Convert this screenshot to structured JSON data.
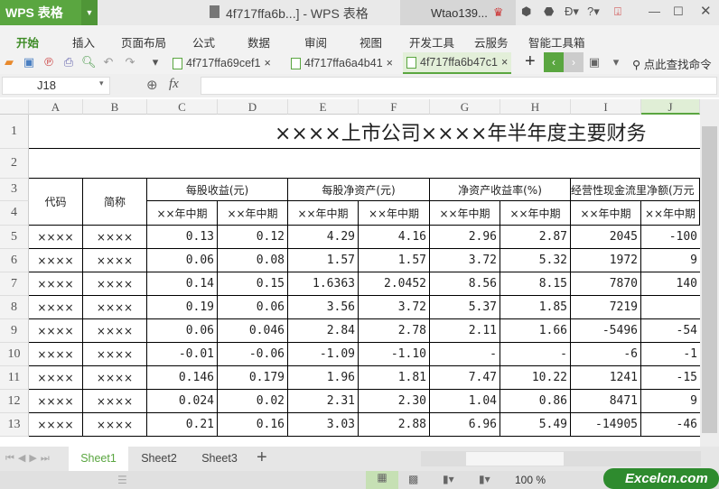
{
  "app": {
    "name": "WPS 表格",
    "doc_title": "4f717ffa6b...] - WPS 表格",
    "user": "Wtao139..."
  },
  "menu": [
    "开始",
    "插入",
    "页面布局",
    "公式",
    "数据",
    "审阅",
    "视图",
    "开发工具",
    "云服务",
    "智能工具箱"
  ],
  "doc_tabs": [
    {
      "label": "4f717ffa69cef1",
      "active": false
    },
    {
      "label": "4f717ffa6a4b41",
      "active": false
    },
    {
      "label": "4f717ffa6b47c1",
      "active": true
    }
  ],
  "search_cmd": "点此查找命令",
  "name_box": "J18",
  "fx": "fx",
  "columns": [
    "A",
    "B",
    "C",
    "D",
    "E",
    "F",
    "G",
    "H",
    "I",
    "J"
  ],
  "selected_column": "J",
  "rows": [
    "1",
    "2",
    "3",
    "4",
    "5",
    "6",
    "7",
    "8",
    "9",
    "10",
    "11",
    "12",
    "13"
  ],
  "table": {
    "title": "××××上市公司××××年半年度主要财务",
    "h_code": "代码",
    "h_name": "简称",
    "groups": [
      "每股收益(元)",
      "每股净资产(元)",
      "净资产收益率(%)",
      "经营性现金流里净额(万元"
    ],
    "period": "××年中期",
    "data": [
      [
        "××××",
        "××××",
        "0.13",
        "0.12",
        "4.29",
        "4.16",
        "2.96",
        "2.87",
        "2045",
        "-100"
      ],
      [
        "××××",
        "××××",
        "0.06",
        "0.08",
        "1.57",
        "1.57",
        "3.72",
        "5.32",
        "1972",
        "9"
      ],
      [
        "××××",
        "××××",
        "0.14",
        "0.15",
        "1.6363",
        "2.0452",
        "8.56",
        "8.15",
        "7870",
        "140"
      ],
      [
        "××××",
        "××××",
        "0.19",
        "0.06",
        "3.56",
        "3.72",
        "5.37",
        "1.85",
        "7219",
        ""
      ],
      [
        "××××",
        "××××",
        "0.06",
        "0.046",
        "2.84",
        "2.78",
        "2.11",
        "1.66",
        "-5496",
        "-54"
      ],
      [
        "××××",
        "××××",
        "-0.01",
        "-0.06",
        "-1.09",
        "-1.10",
        "-",
        "-",
        "-6",
        "-1"
      ],
      [
        "××××",
        "××××",
        "0.146",
        "0.179",
        "1.96",
        "1.81",
        "7.47",
        "10.22",
        "1241",
        "-15"
      ],
      [
        "××××",
        "××××",
        "0.024",
        "0.02",
        "2.31",
        "2.30",
        "1.04",
        "0.86",
        "8471",
        "9"
      ],
      [
        "××××",
        "××××",
        "0.21",
        "0.16",
        "3.03",
        "2.88",
        "6.96",
        "5.49",
        "-14905",
        "-46"
      ]
    ]
  },
  "sheets": [
    {
      "label": "Sheet1",
      "active": true
    },
    {
      "label": "Sheet2",
      "active": false
    },
    {
      "label": "Sheet3",
      "active": false
    }
  ],
  "zoom": "100 %",
  "watermark": "Excelcn.com",
  "colors": {
    "accent": "#5aa640"
  }
}
